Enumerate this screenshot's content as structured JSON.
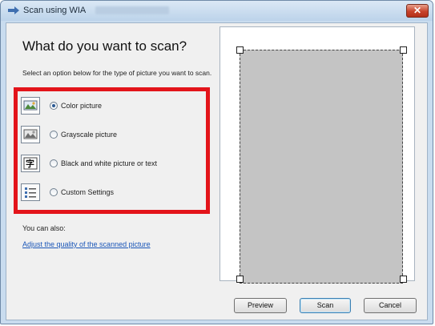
{
  "window": {
    "title": "Scan using WIA",
    "close_icon": "close-icon",
    "app_icon": "scanner-arrow-icon"
  },
  "main": {
    "heading": "What do you want to scan?",
    "instructions": "Select an option below for the type of picture you want to scan.",
    "options": [
      {
        "label": "Color picture",
        "checked": true,
        "icon": "color-picture-icon"
      },
      {
        "label": "Grayscale picture",
        "checked": false,
        "icon": "grayscale-picture-icon"
      },
      {
        "label": "Black and white picture or text",
        "checked": false,
        "icon": "black-white-text-icon"
      },
      {
        "label": "Custom Settings",
        "checked": false,
        "icon": "custom-settings-icon"
      }
    ],
    "also_label": "You can also:",
    "quality_link": "Adjust the quality of the scanned picture"
  },
  "buttons": {
    "preview": "Preview",
    "scan": "Scan",
    "cancel": "Cancel"
  },
  "colors": {
    "highlight_border": "#e3141a",
    "link": "#1a56b8",
    "scan_area": "#c4c4c4"
  }
}
